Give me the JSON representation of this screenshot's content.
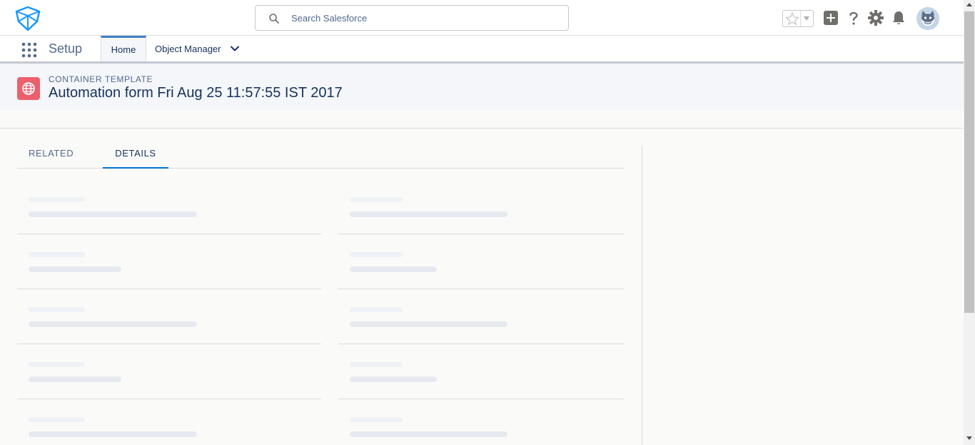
{
  "header": {
    "logo": "salesforce-trailhead-logo",
    "search": {
      "placeholder": "Search Salesforce",
      "value": ""
    },
    "actions": [
      "favorites-star",
      "favorites-dropdown",
      "add",
      "help",
      "setup-gear",
      "notifications-bell",
      "user-avatar"
    ]
  },
  "context_bar": {
    "app_launcher": "app-launcher-grid",
    "app_name": "Setup",
    "tabs": [
      {
        "label": "Home",
        "active": true
      },
      {
        "label": "Object Manager",
        "active": false,
        "has_dropdown": true
      }
    ]
  },
  "record": {
    "type": "CONTAINER TEMPLATE",
    "title": "Automation form Fri Aug 25 11:57:55 IST 2017",
    "icon": "globe-icon",
    "icon_color": "#ec5f6c"
  },
  "detail_tabs": [
    {
      "label": "RELATED",
      "active": false
    },
    {
      "label": "DETAILS",
      "active": true
    }
  ],
  "colors": {
    "accent": "#0070d2",
    "text": "#16325c",
    "muted": "#54698d"
  }
}
